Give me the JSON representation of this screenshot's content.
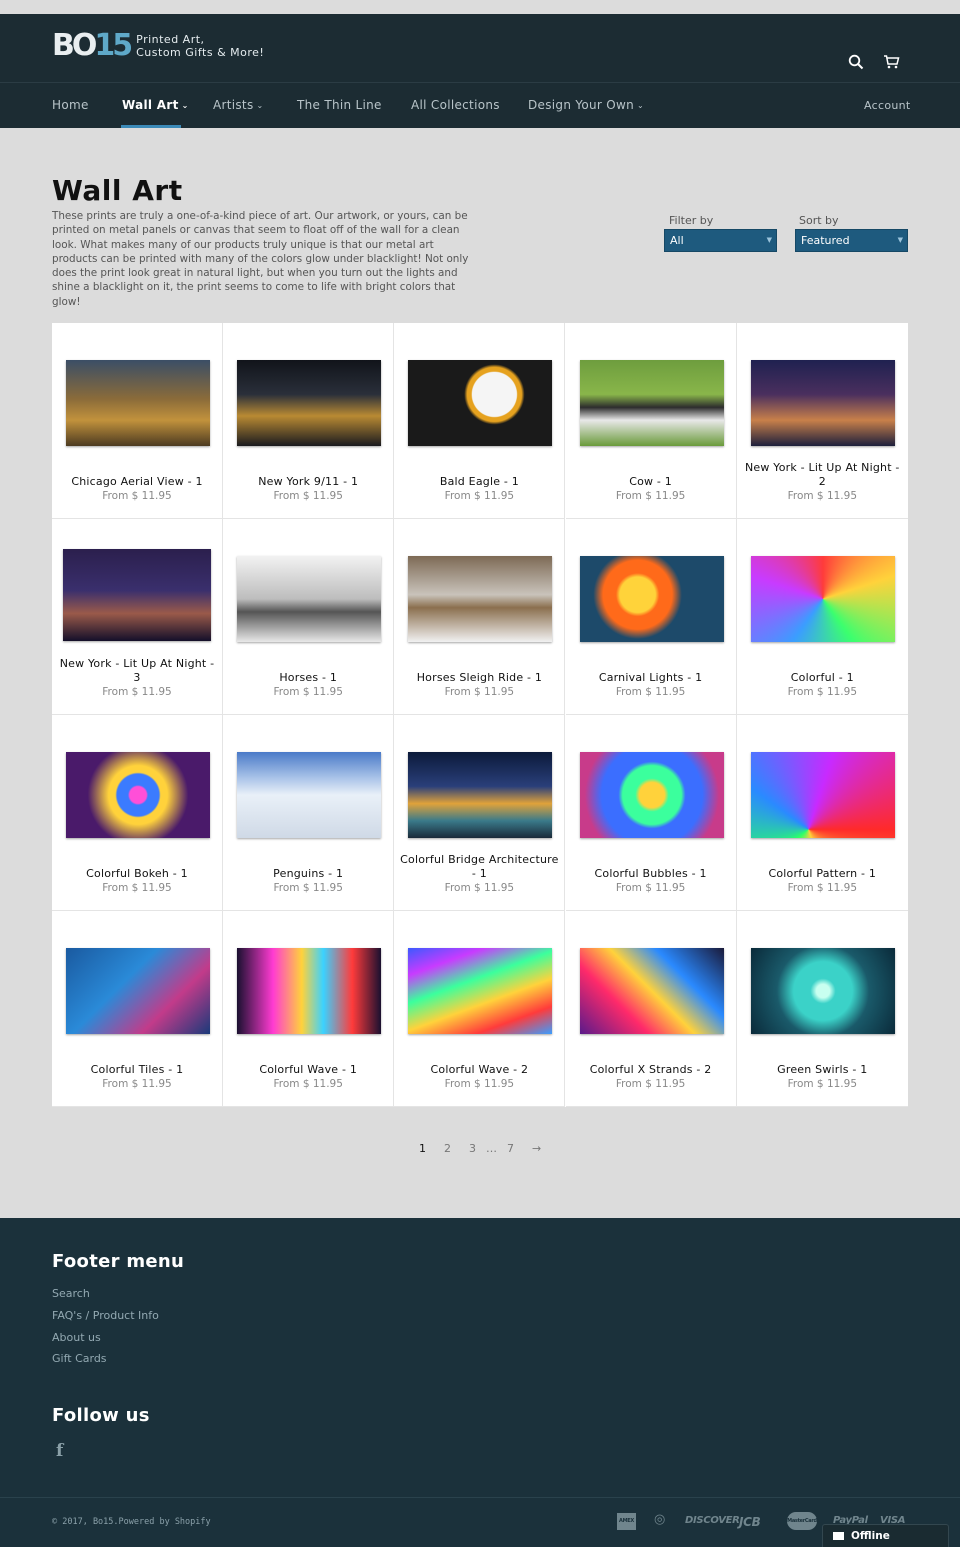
{
  "header": {
    "logo_text": "BO",
    "logo_num": "15",
    "tagline_1": "Printed Art,",
    "tagline_2": "Custom Gifts & More!",
    "search_icon": "search-icon",
    "cart_icon": "cart-icon"
  },
  "nav": {
    "items": [
      {
        "label": "Home"
      },
      {
        "label": "Wall Art",
        "active": true
      },
      {
        "label": "Artists"
      },
      {
        "label": "The Thin Line"
      },
      {
        "label": "All Collections"
      },
      {
        "label": "Design Your Own"
      }
    ],
    "account": "Account",
    "caret": "⌄",
    "accent": "#3b8ab8"
  },
  "collection": {
    "title": "Wall Art",
    "description": "These prints are truly a one-of-a-kind piece of art. Our artwork, or yours, can be printed on metal panels or canvas that seem to float off of the wall for a clean look. What makes many of our products truly unique is that our metal art products can be printed with many of the colors glow under blacklight! Not only does the print look great in natural light, but when you turn out the lights and shine a blacklight on it, the print seems to come to life with bright colors that glow!"
  },
  "controls": {
    "filter_label": "Filter by",
    "filter_value": "All",
    "sort_label": "Sort by",
    "sort_value": "Featured",
    "select_color": "#1e5a7e"
  },
  "products": [
    {
      "name": "Chicago Aerial View - 1",
      "price": "From $ 11.95"
    },
    {
      "name": "New York 9/11 - 1",
      "price": "From $ 11.95"
    },
    {
      "name": "Bald Eagle - 1",
      "price": "From $ 11.95"
    },
    {
      "name": "Cow - 1",
      "price": "From $ 11.95"
    },
    {
      "name": "New York - Lit Up At Night - 2",
      "price": "From $ 11.95"
    },
    {
      "name": "New York - Lit Up At Night - 3",
      "price": "From $ 11.95"
    },
    {
      "name": "Horses - 1",
      "price": "From $ 11.95"
    },
    {
      "name": "Horses Sleigh Ride - 1",
      "price": "From $ 11.95"
    },
    {
      "name": "Carnival Lights - 1",
      "price": "From $ 11.95"
    },
    {
      "name": "Colorful - 1",
      "price": "From $ 11.95"
    },
    {
      "name": "Colorful Bokeh - 1",
      "price": "From $ 11.95"
    },
    {
      "name": "Penguins - 1",
      "price": "From $ 11.95"
    },
    {
      "name": "Colorful Bridge Architecture - 1",
      "price": "From $ 11.95"
    },
    {
      "name": "Colorful Bubbles - 1",
      "price": "From $ 11.95"
    },
    {
      "name": "Colorful Pattern - 1",
      "price": "From $ 11.95"
    },
    {
      "name": "Colorful Tiles - 1",
      "price": "From $ 11.95"
    },
    {
      "name": "Colorful Wave - 1",
      "price": "From $ 11.95"
    },
    {
      "name": "Colorful Wave - 2",
      "price": "From $ 11.95"
    },
    {
      "name": "Colorful X Strands - 2",
      "price": "From $ 11.95"
    },
    {
      "name": "Green Swirls - 1",
      "price": "From $ 11.95"
    }
  ],
  "pagination": {
    "pages": [
      "1",
      "2",
      "3",
      "…",
      "7"
    ],
    "current": "1",
    "next": "→"
  },
  "footer": {
    "menu_title": "Footer menu",
    "links": [
      "Search",
      "FAQ's / Product Info",
      "About us",
      "Gift Cards"
    ],
    "follow_title": "Follow us",
    "facebook": "f",
    "copyright": "© 2017, Bo15.Powered by Shopify",
    "payments": [
      "AMEX",
      "diners",
      "DISCOVER",
      "JCB",
      "MasterCard",
      "PayPal",
      "VISA"
    ],
    "bg_color": "#1b313b"
  },
  "chat": {
    "label": "Offline"
  }
}
